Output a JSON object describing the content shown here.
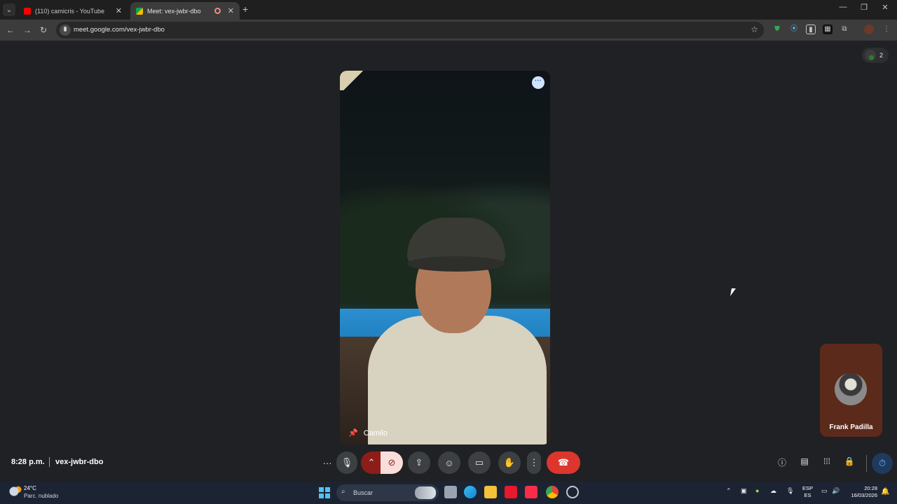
{
  "browser": {
    "tabs": [
      {
        "label": "(110) camicris - YouTube",
        "favicon_color": "#ff0000"
      },
      {
        "label": "Meet: vex-jwbr-dbo",
        "favicon_color": "#00ac47"
      }
    ],
    "url": "meet.google.com/vex-jwbr-dbo"
  },
  "meet": {
    "participant_count": "2",
    "main_participant": "Camilo",
    "self_participant": "Frank Padilla",
    "time": "8:28 p.m.",
    "meeting_code": "vex-jwbr-dbo",
    "controls": [
      "more-options",
      "microphone",
      "camera-options",
      "camera-off",
      "present-screen",
      "reactions",
      "captions",
      "raise-hand",
      "more-actions",
      "leave-call"
    ],
    "right_controls": [
      "meeting-details",
      "chat",
      "activities",
      "host-controls",
      "timer"
    ]
  },
  "taskbar": {
    "weather_temp": "24°C",
    "weather_desc": "Parc. nublado",
    "search_placeholder": "Buscar",
    "lang_top": "ESP",
    "lang_bottom": "ES",
    "time": "20:28",
    "date": "16/03/2026"
  },
  "colors": {
    "end_call": "#dc362e",
    "camera_off_bg": "#f9dedc",
    "accent": "#8ab4f8"
  }
}
